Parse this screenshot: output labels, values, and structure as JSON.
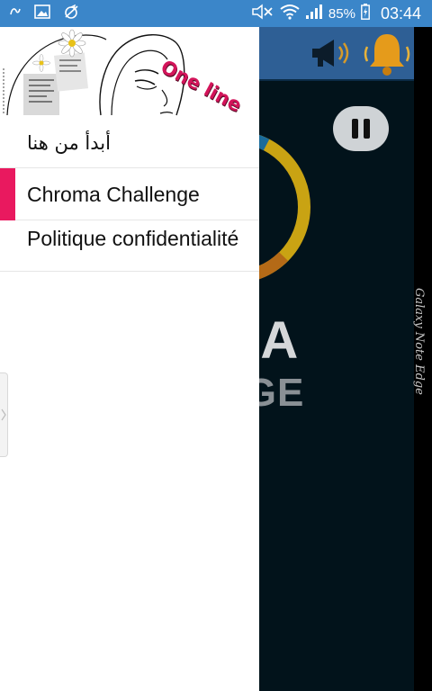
{
  "status_bar": {
    "battery": "85%",
    "time": "03:44"
  },
  "drawer": {
    "header_logo_text": "One line",
    "items": [
      {
        "label": "أبدأ من هنا"
      },
      {
        "label": "Chroma Challenge",
        "active": true
      },
      {
        "label": "Politique confidentialité"
      }
    ]
  },
  "app": {
    "title_line1": "MA",
    "title_line2": "NGE"
  },
  "device": {
    "edge_label": "Galaxy Note Edge"
  },
  "colors": {
    "status_bar": "#3b86c9",
    "accent": "#e9195f",
    "app_background": "#02131b",
    "app_topbar": "#2e5f95"
  }
}
